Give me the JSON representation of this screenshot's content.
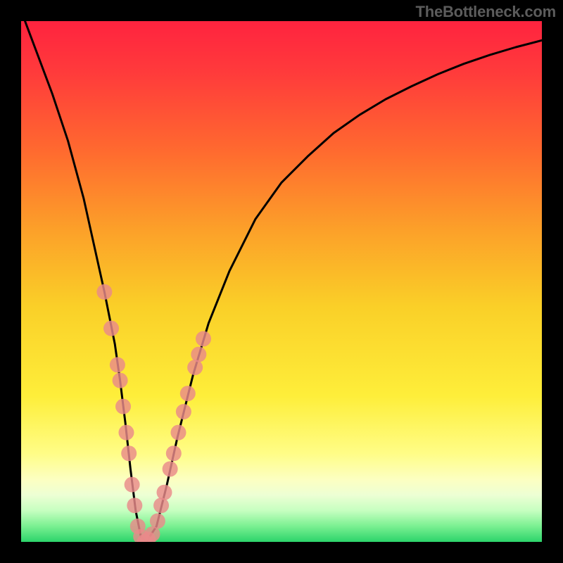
{
  "attribution": "TheBottleneck.com",
  "accent_colors": {
    "curve": "#000000",
    "marker_fill": "#e98a8a",
    "marker_stroke": "#d96f6f"
  },
  "gradient_stops": [
    {
      "offset": 0.0,
      "color": "#ff233f"
    },
    {
      "offset": 0.1,
      "color": "#ff3b3b"
    },
    {
      "offset": 0.25,
      "color": "#ff6a2f"
    },
    {
      "offset": 0.4,
      "color": "#fca029"
    },
    {
      "offset": 0.55,
      "color": "#fad028"
    },
    {
      "offset": 0.72,
      "color": "#feee3a"
    },
    {
      "offset": 0.83,
      "color": "#fffd86"
    },
    {
      "offset": 0.88,
      "color": "#fcffc1"
    },
    {
      "offset": 0.91,
      "color": "#edffd4"
    },
    {
      "offset": 0.94,
      "color": "#c6ffc0"
    },
    {
      "offset": 0.97,
      "color": "#7af091"
    },
    {
      "offset": 1.0,
      "color": "#2cd46b"
    }
  ],
  "chart_data": {
    "type": "line",
    "title": "",
    "xlabel": "",
    "ylabel": "",
    "xlim": [
      0,
      100
    ],
    "ylim": [
      0,
      100
    ],
    "series": [
      {
        "name": "bottleneck-curve",
        "x": [
          0,
          3,
          6,
          9,
          12,
          14,
          16,
          18,
          19,
          20,
          21,
          22,
          23,
          24,
          26,
          28,
          30,
          33,
          36,
          40,
          45,
          50,
          55,
          60,
          65,
          70,
          75,
          80,
          85,
          90,
          95,
          100
        ],
        "y": [
          102,
          94,
          86,
          77,
          66,
          57,
          48,
          38,
          31,
          23,
          14,
          6,
          1,
          0,
          3,
          11,
          20,
          32,
          42,
          52,
          62,
          69,
          74,
          78.5,
          82,
          85,
          87.5,
          89.8,
          91.8,
          93.5,
          95,
          96.3
        ]
      }
    ],
    "markers": {
      "name": "highlighted-range",
      "points": [
        {
          "x": 16.0,
          "y": 48
        },
        {
          "x": 17.3,
          "y": 41
        },
        {
          "x": 18.5,
          "y": 34
        },
        {
          "x": 19.0,
          "y": 31
        },
        {
          "x": 19.6,
          "y": 26
        },
        {
          "x": 20.2,
          "y": 21
        },
        {
          "x": 20.7,
          "y": 17
        },
        {
          "x": 21.3,
          "y": 11
        },
        {
          "x": 21.8,
          "y": 7
        },
        {
          "x": 22.4,
          "y": 3
        },
        {
          "x": 23.0,
          "y": 1
        },
        {
          "x": 23.7,
          "y": 0
        },
        {
          "x": 24.4,
          "y": 0.5
        },
        {
          "x": 25.2,
          "y": 1.5
        },
        {
          "x": 26.2,
          "y": 4
        },
        {
          "x": 26.9,
          "y": 7
        },
        {
          "x": 27.5,
          "y": 9.5
        },
        {
          "x": 28.6,
          "y": 14
        },
        {
          "x": 29.3,
          "y": 17
        },
        {
          "x": 30.2,
          "y": 21
        },
        {
          "x": 31.2,
          "y": 25
        },
        {
          "x": 32.0,
          "y": 28.5
        },
        {
          "x": 33.4,
          "y": 33.5
        },
        {
          "x": 34.1,
          "y": 36
        },
        {
          "x": 35.0,
          "y": 39
        }
      ]
    }
  }
}
